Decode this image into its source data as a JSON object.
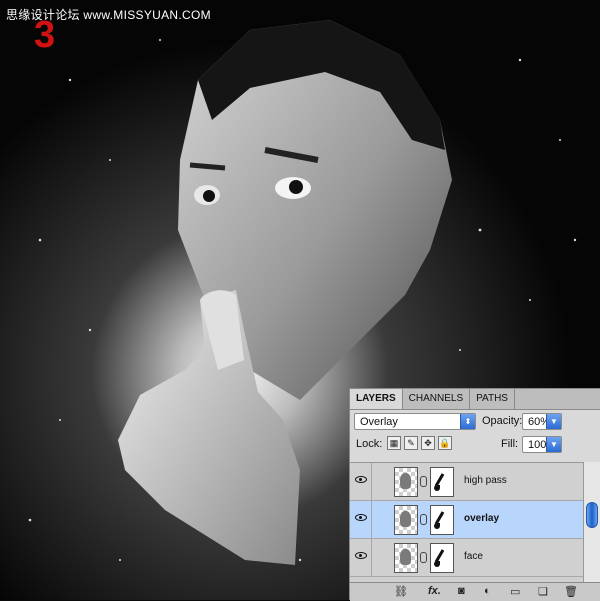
{
  "watermark": "思缘设计论坛 www.MISSYUAN.COM",
  "step": "3",
  "panel": {
    "tabs": [
      {
        "label": "LAYERS",
        "active": true
      },
      {
        "label": "CHANNELS",
        "active": false
      },
      {
        "label": "PATHS",
        "active": false
      }
    ],
    "blend_mode": "Overlay",
    "opacity_label": "Opacity:",
    "opacity_value": "60%",
    "lock_label": "Lock:",
    "fill_label": "Fill:",
    "fill_value": "100%",
    "layers": [
      {
        "name": "high pass",
        "visible": true,
        "selected": false
      },
      {
        "name": "overlay",
        "visible": true,
        "selected": true
      },
      {
        "name": "face",
        "visible": true,
        "selected": false
      }
    ],
    "bottom_icons": [
      "link-icon",
      "fx-icon",
      "add-mask-icon",
      "adjustment-icon",
      "folder-icon",
      "new-layer-icon",
      "trash-icon"
    ],
    "fx_label": "fx."
  }
}
